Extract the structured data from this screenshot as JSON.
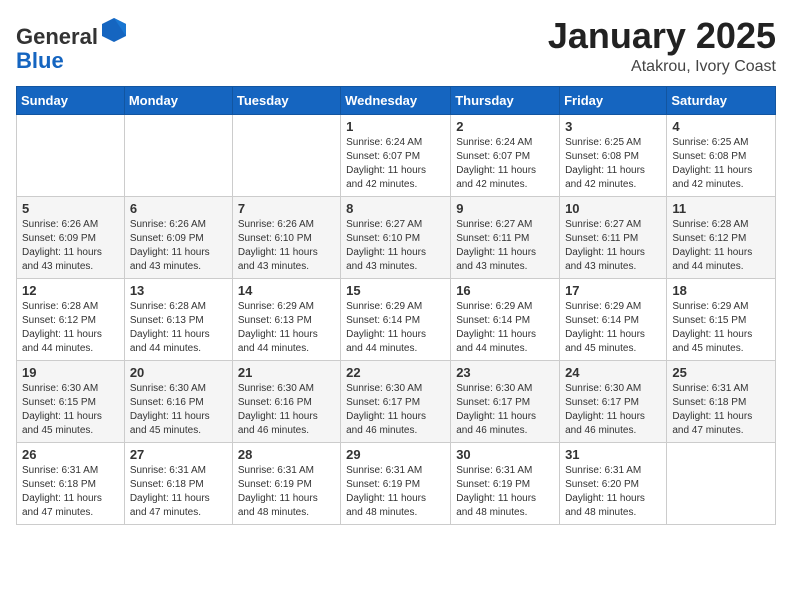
{
  "header": {
    "logo_general": "General",
    "logo_blue": "Blue",
    "month": "January 2025",
    "location": "Atakrou, Ivory Coast"
  },
  "weekdays": [
    "Sunday",
    "Monday",
    "Tuesday",
    "Wednesday",
    "Thursday",
    "Friday",
    "Saturday"
  ],
  "weeks": [
    [
      {
        "day": "",
        "info": ""
      },
      {
        "day": "",
        "info": ""
      },
      {
        "day": "",
        "info": ""
      },
      {
        "day": "1",
        "info": "Sunrise: 6:24 AM\nSunset: 6:07 PM\nDaylight: 11 hours\nand 42 minutes."
      },
      {
        "day": "2",
        "info": "Sunrise: 6:24 AM\nSunset: 6:07 PM\nDaylight: 11 hours\nand 42 minutes."
      },
      {
        "day": "3",
        "info": "Sunrise: 6:25 AM\nSunset: 6:08 PM\nDaylight: 11 hours\nand 42 minutes."
      },
      {
        "day": "4",
        "info": "Sunrise: 6:25 AM\nSunset: 6:08 PM\nDaylight: 11 hours\nand 42 minutes."
      }
    ],
    [
      {
        "day": "5",
        "info": "Sunrise: 6:26 AM\nSunset: 6:09 PM\nDaylight: 11 hours\nand 43 minutes."
      },
      {
        "day": "6",
        "info": "Sunrise: 6:26 AM\nSunset: 6:09 PM\nDaylight: 11 hours\nand 43 minutes."
      },
      {
        "day": "7",
        "info": "Sunrise: 6:26 AM\nSunset: 6:10 PM\nDaylight: 11 hours\nand 43 minutes."
      },
      {
        "day": "8",
        "info": "Sunrise: 6:27 AM\nSunset: 6:10 PM\nDaylight: 11 hours\nand 43 minutes."
      },
      {
        "day": "9",
        "info": "Sunrise: 6:27 AM\nSunset: 6:11 PM\nDaylight: 11 hours\nand 43 minutes."
      },
      {
        "day": "10",
        "info": "Sunrise: 6:27 AM\nSunset: 6:11 PM\nDaylight: 11 hours\nand 43 minutes."
      },
      {
        "day": "11",
        "info": "Sunrise: 6:28 AM\nSunset: 6:12 PM\nDaylight: 11 hours\nand 44 minutes."
      }
    ],
    [
      {
        "day": "12",
        "info": "Sunrise: 6:28 AM\nSunset: 6:12 PM\nDaylight: 11 hours\nand 44 minutes."
      },
      {
        "day": "13",
        "info": "Sunrise: 6:28 AM\nSunset: 6:13 PM\nDaylight: 11 hours\nand 44 minutes."
      },
      {
        "day": "14",
        "info": "Sunrise: 6:29 AM\nSunset: 6:13 PM\nDaylight: 11 hours\nand 44 minutes."
      },
      {
        "day": "15",
        "info": "Sunrise: 6:29 AM\nSunset: 6:14 PM\nDaylight: 11 hours\nand 44 minutes."
      },
      {
        "day": "16",
        "info": "Sunrise: 6:29 AM\nSunset: 6:14 PM\nDaylight: 11 hours\nand 44 minutes."
      },
      {
        "day": "17",
        "info": "Sunrise: 6:29 AM\nSunset: 6:14 PM\nDaylight: 11 hours\nand 45 minutes."
      },
      {
        "day": "18",
        "info": "Sunrise: 6:29 AM\nSunset: 6:15 PM\nDaylight: 11 hours\nand 45 minutes."
      }
    ],
    [
      {
        "day": "19",
        "info": "Sunrise: 6:30 AM\nSunset: 6:15 PM\nDaylight: 11 hours\nand 45 minutes."
      },
      {
        "day": "20",
        "info": "Sunrise: 6:30 AM\nSunset: 6:16 PM\nDaylight: 11 hours\nand 45 minutes."
      },
      {
        "day": "21",
        "info": "Sunrise: 6:30 AM\nSunset: 6:16 PM\nDaylight: 11 hours\nand 46 minutes."
      },
      {
        "day": "22",
        "info": "Sunrise: 6:30 AM\nSunset: 6:17 PM\nDaylight: 11 hours\nand 46 minutes."
      },
      {
        "day": "23",
        "info": "Sunrise: 6:30 AM\nSunset: 6:17 PM\nDaylight: 11 hours\nand 46 minutes."
      },
      {
        "day": "24",
        "info": "Sunrise: 6:30 AM\nSunset: 6:17 PM\nDaylight: 11 hours\nand 46 minutes."
      },
      {
        "day": "25",
        "info": "Sunrise: 6:31 AM\nSunset: 6:18 PM\nDaylight: 11 hours\nand 47 minutes."
      }
    ],
    [
      {
        "day": "26",
        "info": "Sunrise: 6:31 AM\nSunset: 6:18 PM\nDaylight: 11 hours\nand 47 minutes."
      },
      {
        "day": "27",
        "info": "Sunrise: 6:31 AM\nSunset: 6:18 PM\nDaylight: 11 hours\nand 47 minutes."
      },
      {
        "day": "28",
        "info": "Sunrise: 6:31 AM\nSunset: 6:19 PM\nDaylight: 11 hours\nand 48 minutes."
      },
      {
        "day": "29",
        "info": "Sunrise: 6:31 AM\nSunset: 6:19 PM\nDaylight: 11 hours\nand 48 minutes."
      },
      {
        "day": "30",
        "info": "Sunrise: 6:31 AM\nSunset: 6:19 PM\nDaylight: 11 hours\nand 48 minutes."
      },
      {
        "day": "31",
        "info": "Sunrise: 6:31 AM\nSunset: 6:20 PM\nDaylight: 11 hours\nand 48 minutes."
      },
      {
        "day": "",
        "info": ""
      }
    ]
  ]
}
